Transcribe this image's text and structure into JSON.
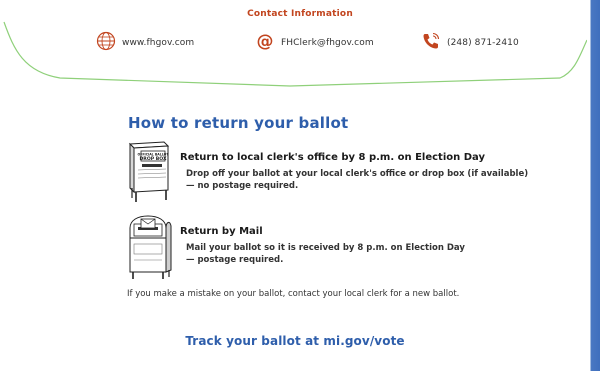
{
  "header": {
    "title": "Contact Information",
    "contacts": [
      {
        "type": "website",
        "text": "www.fhgov.com",
        "icon": "globe-icon"
      },
      {
        "type": "email",
        "text": "FHClerk@fhgov.com",
        "icon": "at-sign-icon"
      },
      {
        "type": "phone",
        "text": "(248) 871-2410",
        "icon": "phone-icon"
      }
    ]
  },
  "section": {
    "title": "How to return your ballot",
    "options": [
      {
        "heading": "Return to local clerk's office by 8 p.m. on Election Day",
        "desc_line1": "Drop off your ballot at your local clerk's office or drop box (if available)",
        "desc_line2": "— no postage required.",
        "illustration": "drop-box-illustration",
        "box_label_line1": "OFFICIAL BALLOT",
        "box_label_line2": "DROP BOX"
      },
      {
        "heading": "Return by Mail",
        "desc_line1": "Mail your ballot so it is received by 8 p.m. on Election Day",
        "desc_line2": "— postage required.",
        "illustration": "mailbox-illustration"
      }
    ],
    "mistake_note": "If you make a mistake on your ballot, contact your local clerk for a new ballot."
  },
  "footer": {
    "track_text": "Track your ballot at mi.gov/vote"
  },
  "colors": {
    "accent_blue": "#2e5eab",
    "header_orange": "#c2451f",
    "flap_green": "#8fd07a",
    "edge_blue": "#3f6fbe"
  }
}
